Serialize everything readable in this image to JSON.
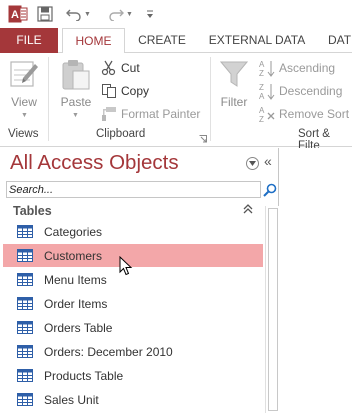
{
  "qat": {
    "app_icon": "access-app-icon",
    "save_icon": "save-icon",
    "undo_icon": "undo-icon",
    "redo_icon": "redo-icon",
    "customize_icon": "customize-qat-icon"
  },
  "tabs": [
    {
      "label": "FILE"
    },
    {
      "label": "HOME"
    },
    {
      "label": "CREATE"
    },
    {
      "label": "EXTERNAL DATA"
    },
    {
      "label": "DAT"
    }
  ],
  "ribbon": {
    "views": {
      "group_label": "Views",
      "view_label": "View"
    },
    "clipboard": {
      "group_label": "Clipboard",
      "paste_label": "Paste",
      "cut_label": "Cut",
      "copy_label": "Copy",
      "format_painter_label": "Format Painter"
    },
    "sort_filter": {
      "group_label": "Sort & Filte",
      "filter_label": "Filter",
      "ascending_label": "Ascending",
      "descending_label": "Descending",
      "remove_sort_label": "Remove Sort"
    }
  },
  "nav_pane": {
    "title": "All Access Objects",
    "search_placeholder": "Search...",
    "group_header": "Tables",
    "items": [
      {
        "label": "Categories",
        "selected": false
      },
      {
        "label": "Customers",
        "selected": true
      },
      {
        "label": "Menu Items",
        "selected": false
      },
      {
        "label": "Order Items",
        "selected": false
      },
      {
        "label": "Orders Table",
        "selected": false
      },
      {
        "label": "Orders: December 2010",
        "selected": false
      },
      {
        "label": "Products Table",
        "selected": false
      },
      {
        "label": "Sales Unit",
        "selected": false
      }
    ]
  },
  "colors": {
    "accent": "#a4373a",
    "selection": "#f3a7a9"
  }
}
